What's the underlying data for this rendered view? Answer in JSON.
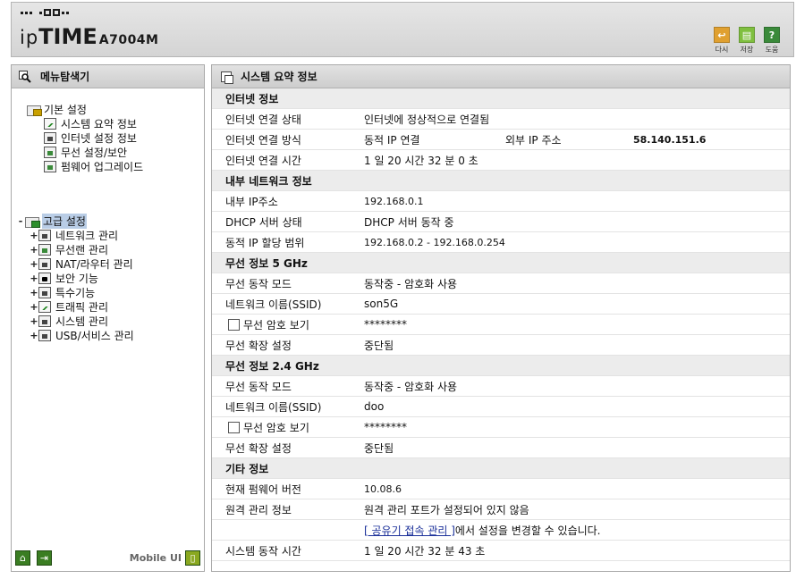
{
  "header": {
    "brand_ip": "ip",
    "brand_time": "TIME",
    "model": "A7004M",
    "buttons": [
      {
        "label": "다시",
        "icon": "reload-icon",
        "color": "#e0a030"
      },
      {
        "label": "저장",
        "icon": "save-icon",
        "color": "#7fbf3f"
      },
      {
        "label": "도움",
        "icon": "help-icon",
        "color": "#3a8a3a"
      }
    ]
  },
  "sidebar": {
    "title": "메뉴탐색기",
    "basic": {
      "label": "기본 설정",
      "items": [
        "시스템 요약 정보",
        "인터넷 설정 정보",
        "무선 설정/보안",
        "펌웨어 업그레이드"
      ]
    },
    "advanced": {
      "toggle": "-",
      "label": "고급 설정",
      "items": [
        "네트워크 관리",
        "무선랜 관리",
        "NAT/라우터 관리",
        "보안 기능",
        "특수기능",
        "트래픽 관리",
        "시스템 관리",
        "USB/서비스 관리"
      ]
    },
    "footer": {
      "mobile_label": "Mobile UI"
    }
  },
  "main": {
    "title": "시스템 요약 정보",
    "internet": {
      "heading": "인터넷 정보",
      "status_label": "인터넷 연결 상태",
      "status_value": "인터넷에 정상적으로 연결됨",
      "method_label": "인터넷 연결 방식",
      "method_value": "동적 IP 연결",
      "ext_ip_label": "외부 IP 주소",
      "ext_ip_value": "58.140.151.6",
      "time_label": "인터넷 연결 시간",
      "time_value": "1 일 20 시간 32 분 0 초"
    },
    "lan": {
      "heading": "내부 네트워크 정보",
      "ip_label": "내부 IP주소",
      "ip_value": "192.168.0.1",
      "dhcp_label": "DHCP 서버 상태",
      "dhcp_value": "DHCP 서버 동작 중",
      "range_label": "동적 IP 할당 범위",
      "range_value": "192.168.0.2 -  192.168.0.254"
    },
    "wifi5": {
      "heading": "무선 정보 5 GHz",
      "mode_label": "무선 동작 모드",
      "mode_value": "동작중 - 암호화 사용",
      "ssid_label": "네트워크 이름(SSID)",
      "ssid_value": "son5G",
      "pw_label": "무선 암호 보기",
      "pw_value": "********",
      "ext_label": "무선 확장 설정",
      "ext_value": "중단됨"
    },
    "wifi24": {
      "heading": "무선 정보 2.4 GHz",
      "mode_label": "무선 동작 모드",
      "mode_value": "동작중 - 암호화 사용",
      "ssid_label": "네트워크 이름(SSID)",
      "ssid_value": "doo",
      "pw_label": "무선 암호 보기",
      "pw_value": "********",
      "ext_label": "무선 확장 설정",
      "ext_value": "중단됨"
    },
    "etc": {
      "heading": "기타 정보",
      "fw_label": "현재 펌웨어 버전",
      "fw_value": "10.08.6",
      "remote_label": "원격 관리 정보",
      "remote_value": "원격 관리 포트가 설정되어 있지 않음",
      "remote_link": "[ 공유기 접속 관리 ]",
      "remote_link_suffix": "에서 설정을 변경할 수 있습니다.",
      "uptime_label": "시스템 동작 시간",
      "uptime_value": "1 일 20 시간 32 분 43 초"
    }
  }
}
